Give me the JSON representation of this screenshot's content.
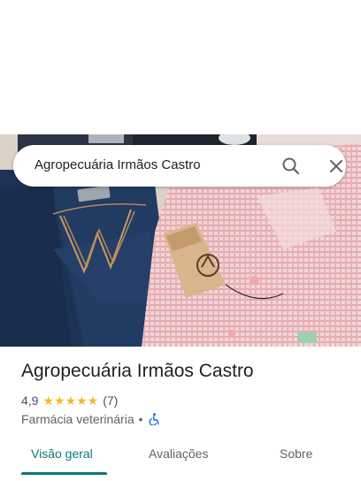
{
  "search": {
    "query": "Agropecuária Irmãos Castro",
    "search_icon": "search-icon",
    "close_icon": "close-icon"
  },
  "place": {
    "name": "Agropecuária Irmãos Castro",
    "rating": "4,9",
    "stars": "★★★★★",
    "review_count": "(7)",
    "category": "Farmácia veterinária",
    "separator": "•",
    "accessibility_icon": "wheelchair-icon"
  },
  "tabs": [
    {
      "label": "Visão geral",
      "active": true
    },
    {
      "label": "Avaliações",
      "active": false
    },
    {
      "label": "Sobre",
      "active": false
    }
  ],
  "colors": {
    "accent": "#0b7a7a",
    "star": "#f7b72d",
    "accessibility": "#1a73e8"
  }
}
